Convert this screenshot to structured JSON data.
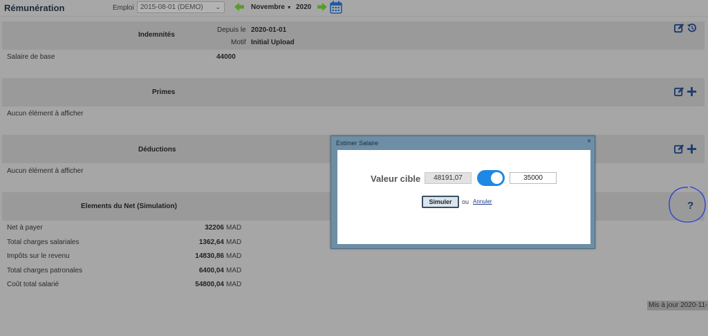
{
  "header": {
    "title": "Rémunération",
    "emploi_label": "Emploi",
    "emploi_value": "2015-08-01 (DEMO)",
    "month": "Novembre",
    "year": "2020",
    "icons": [
      "arrow-left-icon",
      "arrow-right-icon",
      "calendar-icon"
    ]
  },
  "indemnites": {
    "title": "Indemnités",
    "depuis_label": "Depuis le",
    "depuis_value": "2020-01-01",
    "motif_label": "Motif",
    "motif_value": "Initial Upload",
    "rows": [
      {
        "label": "Salaire de base",
        "value": "44000"
      }
    ]
  },
  "primes": {
    "title": "Primes",
    "empty": "Aucun élément à afficher"
  },
  "deductions": {
    "title": "Déductions",
    "empty": "Aucun élément à afficher"
  },
  "net": {
    "title": "Elements du Net (Simulation)",
    "rows": [
      {
        "label": "Net à payer",
        "value": "32206",
        "unit": "MAD"
      },
      {
        "label": "Total charges salariales",
        "value": "1362,64",
        "unit": "MAD"
      },
      {
        "label": "Impôts sur le revenu",
        "value": "14830,86",
        "unit": "MAD"
      },
      {
        "label": "Total charges patronales",
        "value": "6400,04",
        "unit": "MAD"
      },
      {
        "label": "Coût total salarié",
        "value": "54800,04",
        "unit": "MAD"
      }
    ]
  },
  "modal": {
    "title": "Estimer Salaire",
    "close": "×",
    "valeur_label": "Valeur cible",
    "current_value": "48191,07",
    "target_value": "35000",
    "toggle_on": true,
    "simuler": "Simuler",
    "ou": "ou",
    "annuler": "Annuler"
  },
  "help": {
    "symbol": "?"
  },
  "footer": {
    "maj": "Mis à jour 2020-11-"
  },
  "colors": {
    "accent": "#1e88e5",
    "icon": "#1c3a6e",
    "arrow": "#5a9a2a",
    "page_bg": "#a6a6a6"
  }
}
